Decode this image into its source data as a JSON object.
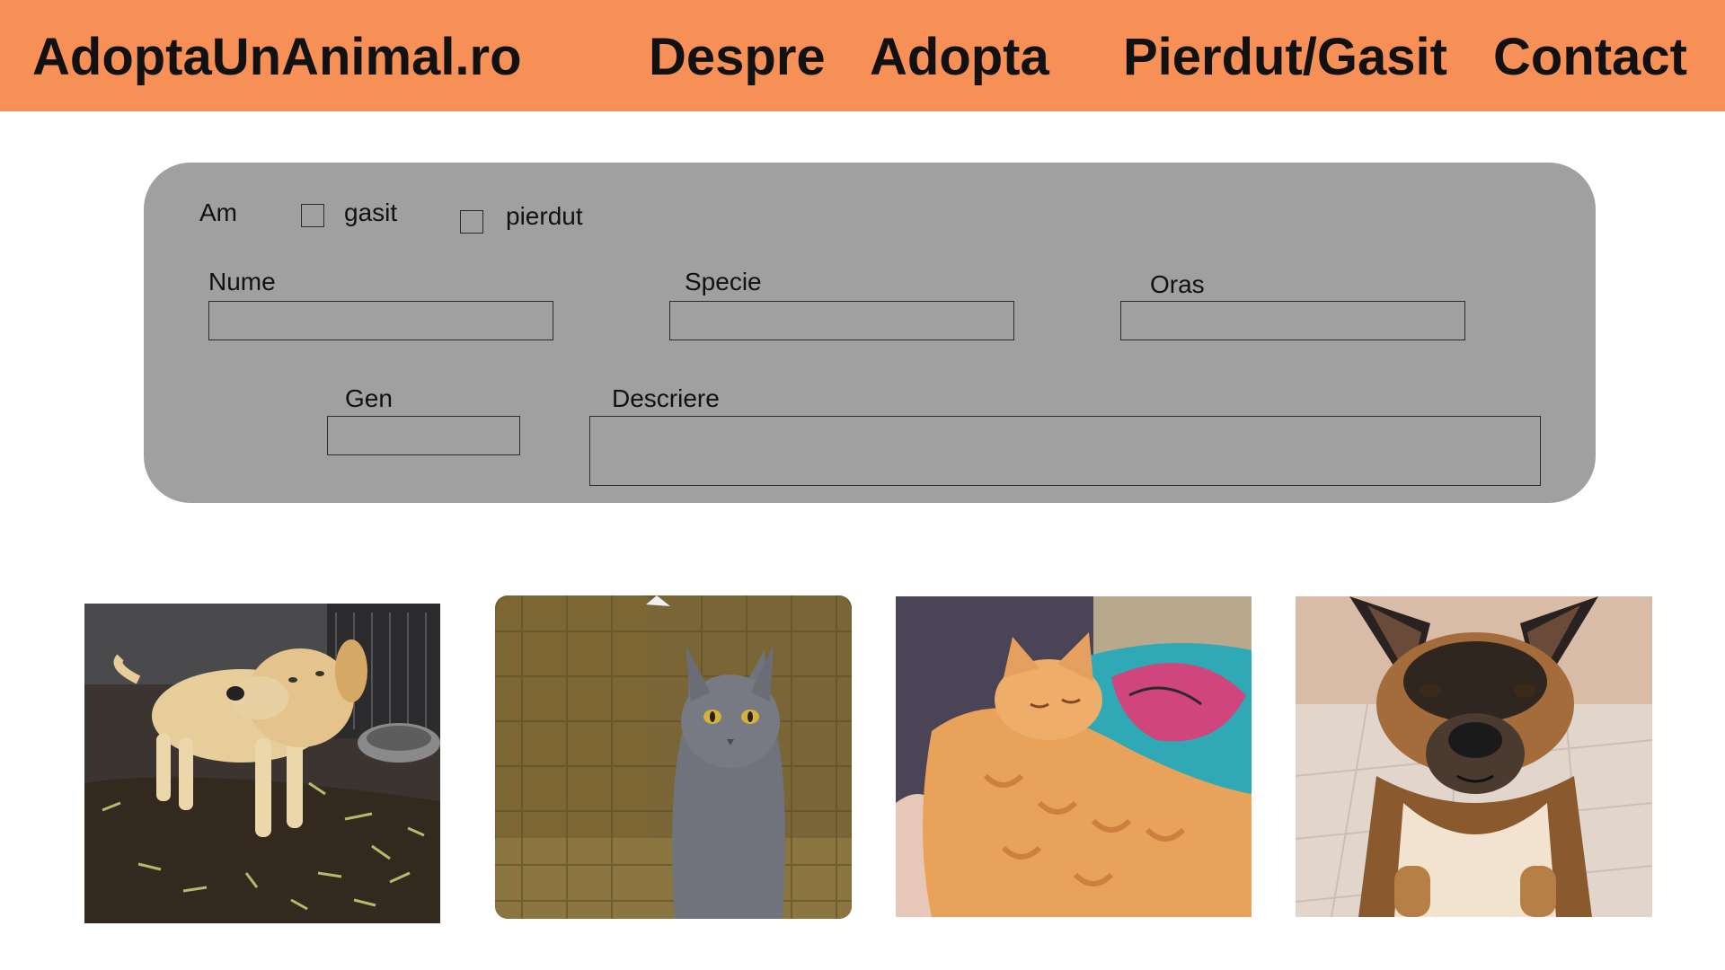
{
  "header": {
    "logo": "AdoptaUnAnimal.ro",
    "nav": {
      "despre": "Despre",
      "adopta": "Adopta",
      "pierdut_gasit": "Pierdut/Gasit",
      "contact": "Contact"
    },
    "background_color": "#f79057"
  },
  "form": {
    "am_label": "Am",
    "gasit_label": "gasit",
    "pierdut_label": "pierdut",
    "gasit_checked": false,
    "pierdut_checked": false,
    "fields": {
      "nume": {
        "label": "Nume",
        "value": ""
      },
      "specie": {
        "label": "Specie",
        "value": ""
      },
      "oras": {
        "label": "Oras",
        "value": ""
      },
      "gen": {
        "label": "Gen",
        "value": ""
      },
      "descriere": {
        "label": "Descriere",
        "value": ""
      }
    },
    "panel_color": "#a0a0a0"
  },
  "gallery": [
    {
      "subject": "light-yellow-dog"
    },
    {
      "subject": "grey-cat-on-sofa"
    },
    {
      "subject": "orange-tabby-cat-sleeping"
    },
    {
      "subject": "german-shepherd-dog"
    }
  ]
}
